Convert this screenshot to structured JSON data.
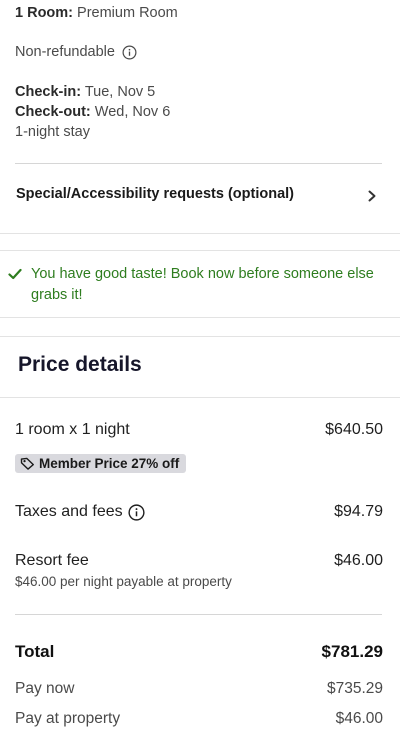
{
  "room": {
    "count_label": "1 Room:",
    "type": "Premium Room",
    "refund_policy": "Non-refundable",
    "checkin_label": "Check-in:",
    "checkin_value": "Tue, Nov 5",
    "checkout_label": "Check-out:",
    "checkout_value": "Wed, Nov 6",
    "stay_length": "1-night stay"
  },
  "special_requests": {
    "label": "Special/Accessibility requests (optional)"
  },
  "notice": {
    "text": "You have good taste! Book now before someone else grabs it!",
    "color": "#2e7d1f"
  },
  "price_details": {
    "title": "Price details",
    "room_line": {
      "label": "1 room x 1 night",
      "value": "$640.50"
    },
    "member_badge": "Member Price 27% off",
    "taxes": {
      "label": "Taxes and fees",
      "value": "$94.79"
    },
    "resort_fee": {
      "label": "Resort fee",
      "value": "$46.00",
      "note": "$46.00 per night payable at property"
    },
    "total": {
      "label": "Total",
      "value": "$781.29"
    },
    "pay_now": {
      "label": "Pay now",
      "value": "$735.29"
    },
    "pay_at_property": {
      "label": "Pay at property",
      "value": "$46.00"
    }
  },
  "icons": {
    "info": "info-circle-icon",
    "chevron": "chevron-right-icon",
    "check": "check-icon",
    "tag": "tag-icon"
  }
}
